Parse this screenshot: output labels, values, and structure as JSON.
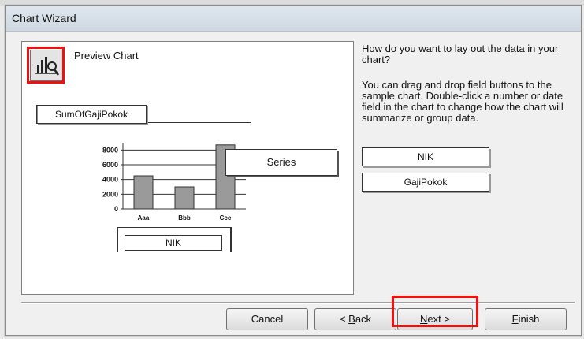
{
  "window": {
    "title": "Chart Wizard"
  },
  "preview": {
    "label_prefix": "P",
    "label_rest": "review Chart",
    "data_field": "SumOfGajiPokok",
    "axis_field": "NIK",
    "series_field": "Series"
  },
  "chart_data": {
    "type": "bar",
    "categories": [
      "Aaa",
      "Bbb",
      "Ccc"
    ],
    "values": [
      4500,
      3000,
      8700
    ],
    "yticks": [
      "8000",
      "6000",
      "4000",
      "2000",
      "0"
    ],
    "ylim": [
      0,
      9000
    ]
  },
  "instructions": {
    "question": "How do you want to lay out the data in your chart?",
    "help": "You can drag and drop field buttons to the sample chart. Double-click a number or date field in the chart to change how the chart will summarize or group data."
  },
  "fields": [
    "NIK",
    "GajiPokok"
  ],
  "buttons": {
    "cancel": "Cancel",
    "back_symbol": "< ",
    "back_accel": "B",
    "back_rest": "ack",
    "next_accel": "N",
    "next_rest": "ext >",
    "finish_accel": "F",
    "finish_rest": "inish"
  },
  "colors": {
    "highlight": "#ee1111"
  }
}
